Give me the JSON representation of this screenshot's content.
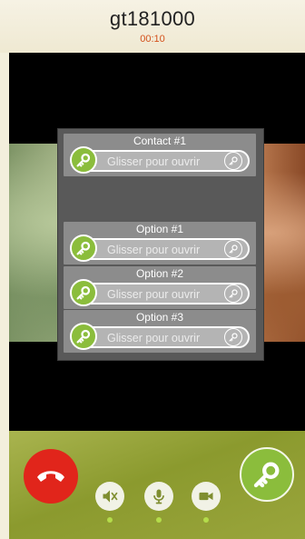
{
  "call": {
    "caller": "gt181000",
    "timer": "00:10"
  },
  "door_panel": {
    "contacts": [
      {
        "title": "Contact #1",
        "slider_text": "Glisser pour ouvrir"
      }
    ],
    "options": [
      {
        "title": "Option #1",
        "slider_text": "Glisser pour ouvrir"
      },
      {
        "title": "Option #2",
        "slider_text": "Glisser pour ouvrir"
      },
      {
        "title": "Option #3",
        "slider_text": "Glisser pour ouvrir"
      }
    ]
  },
  "controls": {
    "icons": {
      "hangup": "phone-hangup-icon",
      "speaker": "speaker-mute-icon",
      "microphone": "microphone-icon",
      "camera": "video-camera-icon",
      "open_door": "key-icon"
    }
  },
  "colors": {
    "accent_green": "#8bbd3c",
    "hangup_red": "#e1251b",
    "timer_orange": "#d4511c",
    "indicator_green": "#b4dc4a"
  }
}
